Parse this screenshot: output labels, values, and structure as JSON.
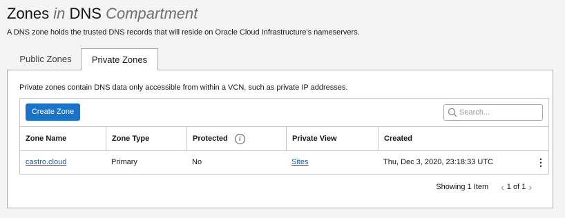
{
  "header": {
    "title_main": "Zones",
    "title_in": "in",
    "title_dns": "DNS",
    "title_compartment": "Compartment",
    "subtitle": "A DNS zone holds the trusted DNS records that will reside on Oracle Cloud Infrastructure's nameservers."
  },
  "tabs": [
    {
      "label": "Public Zones",
      "active": false
    },
    {
      "label": "Private Zones",
      "active": true
    }
  ],
  "panel": {
    "description": "Private zones contain DNS data only accessible from within a VCN, such as private IP addresses.",
    "create_button": "Create Zone",
    "search": {
      "placeholder": "Search...",
      "value": ""
    }
  },
  "table": {
    "columns": [
      "Zone Name",
      "Zone Type",
      "Protected",
      "Private View",
      "Created"
    ],
    "rows": [
      {
        "zone_name": "castro.cloud",
        "zone_type": "Primary",
        "protected": "No",
        "private_view": "Sites",
        "created": "Thu, Dec 3, 2020, 23:18:33 UTC"
      }
    ]
  },
  "pagination": {
    "showing": "Showing 1 Item",
    "page": "1 of 1"
  },
  "colors": {
    "accent": "#1a73c8",
    "link": "#1a5bab",
    "background": "#f4f4f4"
  }
}
